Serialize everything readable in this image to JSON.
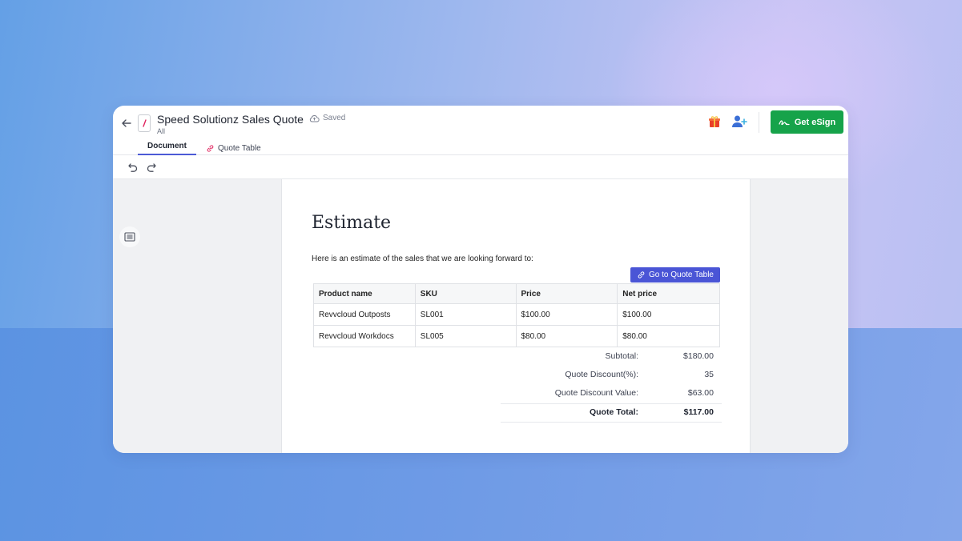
{
  "header": {
    "title": "Speed Solutionz Sales Quote",
    "subtitle": "All",
    "saved_label": "Saved",
    "esign_label": "Get eSign"
  },
  "tabs": [
    {
      "label": "Document"
    },
    {
      "label": "Quote Table"
    }
  ],
  "document": {
    "heading": "Estimate",
    "intro": "Here is an estimate of the sales that we are looking forward to:",
    "goto_button": "Go to Quote Table",
    "table": {
      "columns": [
        "Product name",
        "SKU",
        "Price",
        "Net price"
      ],
      "rows": [
        [
          "Revvcloud Outposts",
          "SL001",
          "$100.00",
          "$100.00"
        ],
        [
          "Revvcloud Workdocs",
          "SL005",
          "$80.00",
          "$80.00"
        ]
      ]
    },
    "summary": [
      {
        "label": "Subtotal:",
        "value": "$180.00"
      },
      {
        "label": "Quote Discount(%):",
        "value": "35"
      },
      {
        "label": "Quote Discount Value:",
        "value": "$63.00"
      },
      {
        "label": "Quote Total:",
        "value": "$117.00"
      }
    ]
  },
  "colors": {
    "accent": "#4a55d6",
    "esign_green": "#16a34a"
  }
}
